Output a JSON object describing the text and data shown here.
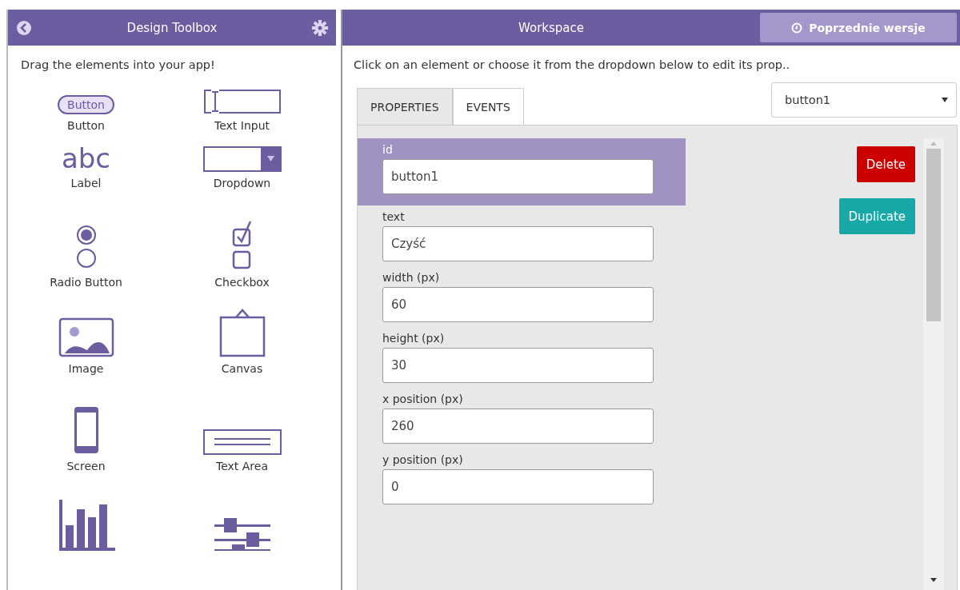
{
  "toolbox": {
    "title": "Design Toolbox",
    "hint": "Drag the elements into your app!",
    "items": [
      {
        "kind": "button",
        "label": "Button",
        "sample": "Button"
      },
      {
        "kind": "text_input",
        "label": "Text Input"
      },
      {
        "kind": "label",
        "label": "Label",
        "sample": "abc"
      },
      {
        "kind": "dropdown",
        "label": "Dropdown"
      },
      {
        "kind": "radio",
        "label": "Radio Button"
      },
      {
        "kind": "checkbox",
        "label": "Checkbox"
      },
      {
        "kind": "image",
        "label": "Image"
      },
      {
        "kind": "canvas",
        "label": "Canvas"
      },
      {
        "kind": "screen",
        "label": "Screen"
      },
      {
        "kind": "text_area",
        "label": "Text Area"
      },
      {
        "kind": "chart"
      },
      {
        "kind": "slider"
      }
    ]
  },
  "workspace": {
    "title": "Workspace",
    "versions_button": "Poprzednie wersje",
    "hint": "Click on an element or choose it from the dropdown below to edit its prop..",
    "tabs": [
      {
        "label": "PROPERTIES",
        "selected": true
      },
      {
        "label": "EVENTS",
        "selected": false
      }
    ],
    "element_select": "button1",
    "properties": [
      {
        "label": "id",
        "value": "button1",
        "selected": true
      },
      {
        "label": "text",
        "value": "Czyść",
        "selected": false
      },
      {
        "label": "width (px)",
        "value": "60",
        "selected": false
      },
      {
        "label": "height (px)",
        "value": "30",
        "selected": false
      },
      {
        "label": "x position (px)",
        "value": "260",
        "selected": false
      },
      {
        "label": "y position (px)",
        "value": "0",
        "selected": false
      }
    ],
    "actions": [
      {
        "kind": "danger",
        "label": "Delete"
      },
      {
        "kind": "copy",
        "label": "Duplicate"
      }
    ]
  }
}
